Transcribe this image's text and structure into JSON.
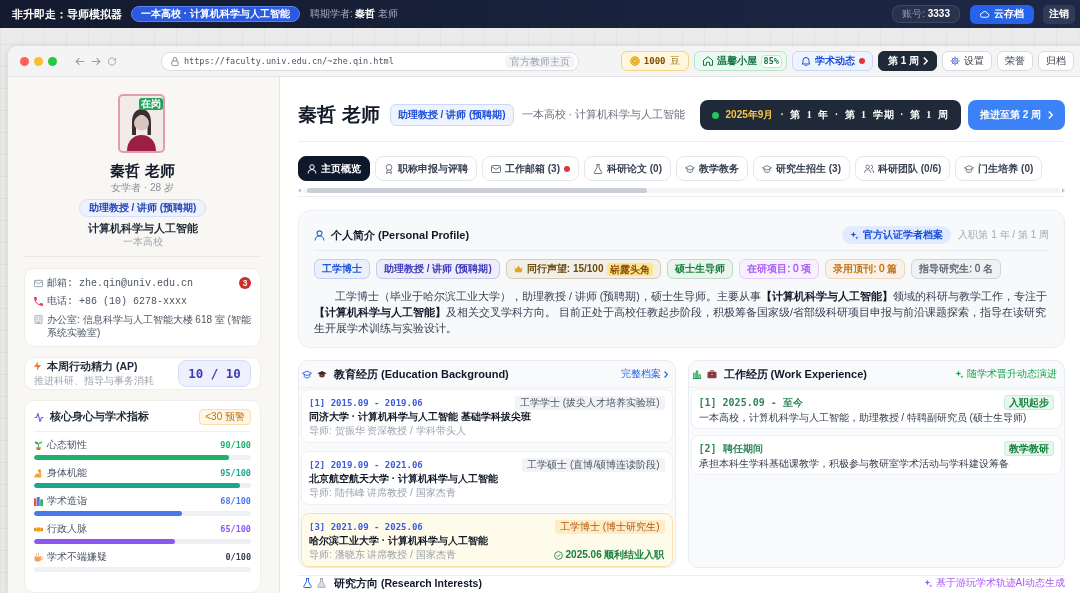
{
  "app_bar": {
    "title": "非升即走：导师模拟器",
    "context_badge": "一本高校 · 计算机科学与人工智能",
    "scholar": "聘期学者: **秦哲** 老师",
    "account": "账号: **3333**",
    "cloud_save_button": "云存档",
    "logout_button": "注销"
  },
  "browser": {
    "url": "https://faculty.univ.edu.cn/~zhe.qin.html",
    "url_tag": "官方教师主页"
  },
  "toolbar": [
    {
      "kind": "coins",
      "label": "1000",
      "suffix": "豆",
      "unread": false
    },
    {
      "kind": "home",
      "label": "温馨小屋",
      "suffix": "85%",
      "unread": false
    },
    {
      "kind": "news",
      "label": "学术动态",
      "unread": true
    },
    {
      "kind": "week",
      "label": "第 1 周",
      "unread": false
    },
    {
      "kind": "settings",
      "label": "设置",
      "unread": false
    },
    {
      "kind": "plain",
      "label": "荣誉",
      "unread": false
    },
    {
      "kind": "plain",
      "label": "归档",
      "unread": false
    }
  ],
  "sidebar": {
    "status_badge": "在岗",
    "name": "秦哲 老师",
    "subtitle": "女学者 · 28 岁",
    "rank": "助理教授 / 讲师 (预聘期)",
    "department": "计算机科学与人工智能",
    "school": "一本高校",
    "contacts": [
      {
        "kind": "email",
        "text": "邮箱: zhe.qin@univ.edu.cn",
        "badge": "3"
      },
      {
        "kind": "phone",
        "text": "电话: +86 (10) 6278-xxxx"
      },
      {
        "kind": "office",
        "text": "办公室: 信息科学与人工智能大楼 618 室 (智能系统实验室)"
      }
    ],
    "energy": {
      "title": "本周行动精力 (AP)",
      "subtitle": "推进科研、指导与事务消耗",
      "value": "10 / 10"
    },
    "metrics": {
      "title": "核心身心与学术指标",
      "warning": "<30 预警",
      "items": [
        {
          "kind": "sprout",
          "label": "心态韧性",
          "value": "90/100",
          "level": 0.9,
          "color": "#1fb26b"
        },
        {
          "kind": "arm",
          "label": "身体机能",
          "value": "95/100",
          "level": 0.95,
          "color": "#17a98a"
        },
        {
          "kind": "books",
          "label": "学术造诣",
          "value": "68/100",
          "level": 0.68,
          "color": "#4a78ec"
        },
        {
          "kind": "hands",
          "label": "行政人脉",
          "value": "65/100",
          "level": 0.65,
          "color": "#8b57f0"
        },
        {
          "kind": "cup",
          "label": "学术不端嫌疑",
          "value": "0/100"
        }
      ]
    }
  },
  "header": {
    "name": "秦哲 老师",
    "rank": "助理教授 / 讲师 (预聘期)",
    "affiliation": "一本高校 · 计算机科学与人工智能",
    "date_month": "2025年9月",
    "date_detail": "· 第 1 年 · 第 1 学期 · 第 1 周",
    "advance_button": "推进至第 2 周"
  },
  "tabs": [
    {
      "kind": "user",
      "label": "主页概览",
      "selected": true,
      "unread": false
    },
    {
      "kind": "award",
      "label": "职称申报与评聘",
      "selected": false,
      "unread": false
    },
    {
      "kind": "mail",
      "label": "工作邮箱 (3)",
      "selected": false,
      "unread": true
    },
    {
      "kind": "flask",
      "label": "科研论文 (0)",
      "selected": false,
      "unread": false
    },
    {
      "kind": "cap",
      "label": "教学教务",
      "selected": false,
      "unread": false
    },
    {
      "kind": "cap",
      "label": "研究生招生 (3)",
      "selected": false,
      "unread": false
    },
    {
      "kind": "users",
      "label": "科研团队 (0/6)",
      "selected": false,
      "unread": false
    },
    {
      "kind": "cap",
      "label": "门生培养 (0)",
      "selected": false,
      "unread": false
    }
  ],
  "profile": {
    "title": "个人简介 (Personal Profile)",
    "verified_badge": "官方认证学者档案",
    "tenure": "入职第 1 年 / 第 1 周",
    "tags": [
      {
        "kind": "bold",
        "label": "工学博士",
        "color": "#1d56d8"
      },
      {
        "kind": "bold",
        "label": "助理教授 / 讲师 (预聘期)",
        "color": "#3f3cbb"
      },
      {
        "kind": "crown",
        "label": "同行声望: 15/100",
        "badge": "崭露头角",
        "color": "#6b4a0c"
      },
      {
        "kind": "bold",
        "label": "硕士生导师",
        "color": "#15803d"
      },
      {
        "kind": "plain",
        "label": "在研项目: 0 项",
        "color": "#a855f7"
      },
      {
        "kind": "plain",
        "label": "录用顶刊: 0 篇",
        "color": "#c2700c"
      },
      {
        "kind": "plain",
        "label": "指导研究生: 0 名",
        "color": "#5b6472"
      }
    ],
    "bio": "工学博士（毕业于哈尔滨工业大学），助理教授 / 讲师 (预聘期)，硕士生导师。主要从事**【计算机科学与人工智能】**领域的科研与教学工作，专注于**【计算机科学与人工智能】**及相关交叉学科方向。 目前正处于高校任教起步阶段，积极筹备国家级/省部级科研项目申报与前沿课题探索，指导在读研究生开展学术训练与实验设计。"
  },
  "education": {
    "title": "教育经历 (Education Background)",
    "link": "完整档案",
    "items": [
      {
        "period": "[1] 2015.09 - 2019.06",
        "degree": "工学学士 (拔尖人才培养实验班)",
        "school": "同济大学 · 计算机科学与人工智能 基础学科拔尖班",
        "advisor": "导师: 贺振华 资深教授 / 学科带头人",
        "highlighted": false
      },
      {
        "period": "[2] 2019.09 - 2021.06",
        "degree": "工学硕士 (直博/硕博连读阶段)",
        "school": "北京航空航天大学 · 计算机科学与人工智能",
        "advisor": "导师: 陆伟峰 讲席教授 / 国家杰青",
        "highlighted": false
      },
      {
        "period": "[3] 2021.09 - 2025.06",
        "degree": "工学博士 (博士研究生)",
        "school": "哈尔滨工业大学 · 计算机科学与人工智能",
        "advisor": "导师: 潘晓东 讲席教授 / 国家杰青",
        "highlighted": true,
        "outcome": "2025.06 顺利结业入职"
      }
    ]
  },
  "work": {
    "title": "工作经历 (Work Experience)",
    "note": "随学术晋升动态演进",
    "items": [
      {
        "period": "[1] 2025.09 - 至今",
        "tag": "入职起步",
        "text": "一本高校，计算机科学与人工智能，助理教授 / 特聘副研究员 (硕士生导师)"
      },
      {
        "period": "[2] 聘任期间",
        "tag": "教学教研",
        "text": "承担本科生学科基础课教学，积极参与教研室学术活动与学科建设筹备"
      }
    ]
  },
  "research": {
    "title": "研究方向 (Research Interests)",
    "note": "基于游玩学术轨迹AI动态生成"
  }
}
